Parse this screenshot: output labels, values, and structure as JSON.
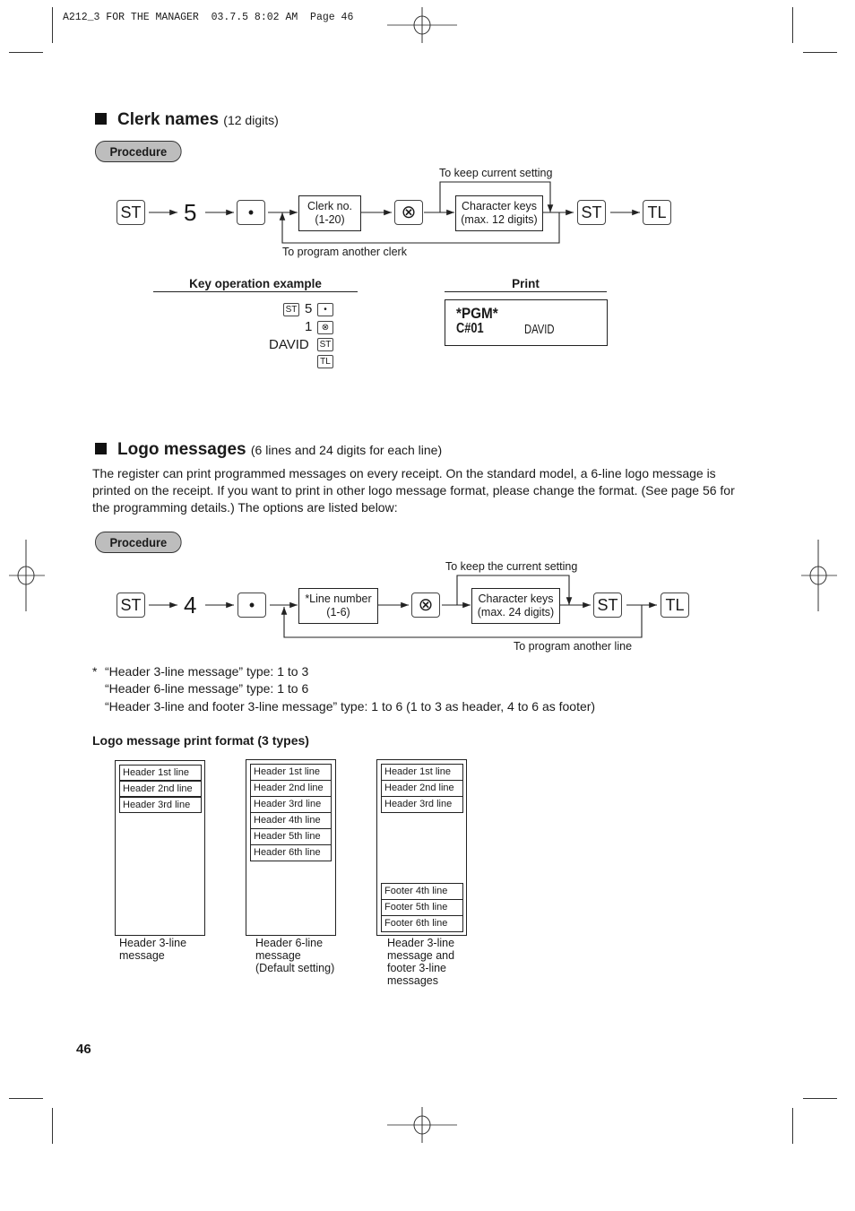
{
  "print_header": "A212_3 FOR THE MANAGER  03.7.5 8:02 AM  Page 46",
  "page_number": "46",
  "clerk_section": {
    "title": "Clerk names",
    "subtitle": "(12 digits)",
    "procedure_label": "Procedure",
    "flow": {
      "key_st": "ST",
      "digit": "5",
      "key_dot": "•",
      "box1_line1": "Clerk no.",
      "box1_line2": "(1-20)",
      "key_x": "⊗",
      "box2_line1": "Character keys",
      "box2_line2": "(max. 12 digits)",
      "key_st2": "ST",
      "key_tl": "TL",
      "label_keep": "To keep current setting",
      "label_loop": "To program another clerk"
    },
    "example": {
      "heading": "Key operation example",
      "rows": [
        {
          "prefix_key": "ST",
          "text": "5",
          "key": "•"
        },
        {
          "prefix_key": "",
          "text": "1",
          "key": "⊗"
        },
        {
          "prefix_key": "",
          "text": "DAVID",
          "key": "ST"
        },
        {
          "prefix_key": "",
          "text": "",
          "key": "TL"
        }
      ]
    },
    "print": {
      "heading": "Print",
      "line1": "*PGM*",
      "line2_code": "C#01",
      "line2_name": "DAVID"
    }
  },
  "logo_section": {
    "title": "Logo messages",
    "subtitle": "(6 lines and 24 digits for each line)",
    "description": "The register can print programmed messages on every receipt. On the standard model, a 6-line logo message is printed on the receipt.  If you want to print in other logo message format, please change the format. (See page 56 for the programming details.)  The options are listed below:",
    "procedure_label": "Procedure",
    "flow": {
      "key_st": "ST",
      "digit": "4",
      "key_dot": "•",
      "box1_line1": "*Line number",
      "box1_line2": "(1-6)",
      "key_x": "⊗",
      "box2_line1": "Character keys",
      "box2_line2": "(max. 24 digits)",
      "key_st2": "ST",
      "key_tl": "TL",
      "label_keep": "To keep the current setting",
      "label_loop": "To program another line"
    },
    "footnote_marker": "*",
    "footnotes": [
      "“Header 3-line message” type: 1 to 3",
      "“Header 6-line message” type: 1 to 6",
      "“Header 3-line and footer 3-line message” type: 1 to 6 (1 to 3 as header, 4 to 6 as footer)"
    ],
    "format_heading": "Logo message print format (3 types)",
    "formats": [
      {
        "header_lines": [
          "Header 1st line",
          "Header 2nd line",
          "Header 3rd line"
        ],
        "footer_lines": [],
        "caption": [
          "Header 3-line",
          "message"
        ]
      },
      {
        "header_lines": [
          "Header 1st line",
          "Header 2nd line",
          "Header 3rd line",
          "Header 4th line",
          "Header 5th line",
          "Header 6th line"
        ],
        "footer_lines": [],
        "caption": [
          "Header 6-line",
          "message",
          "(Default setting)"
        ]
      },
      {
        "header_lines": [
          "Header 1st line",
          "Header 2nd line",
          "Header 3rd line"
        ],
        "footer_lines": [
          "Footer 4th line",
          "Footer 5th line",
          "Footer 6th line"
        ],
        "caption": [
          "Header 3-line",
          "message and",
          "footer 3-line",
          "messages"
        ]
      }
    ]
  }
}
